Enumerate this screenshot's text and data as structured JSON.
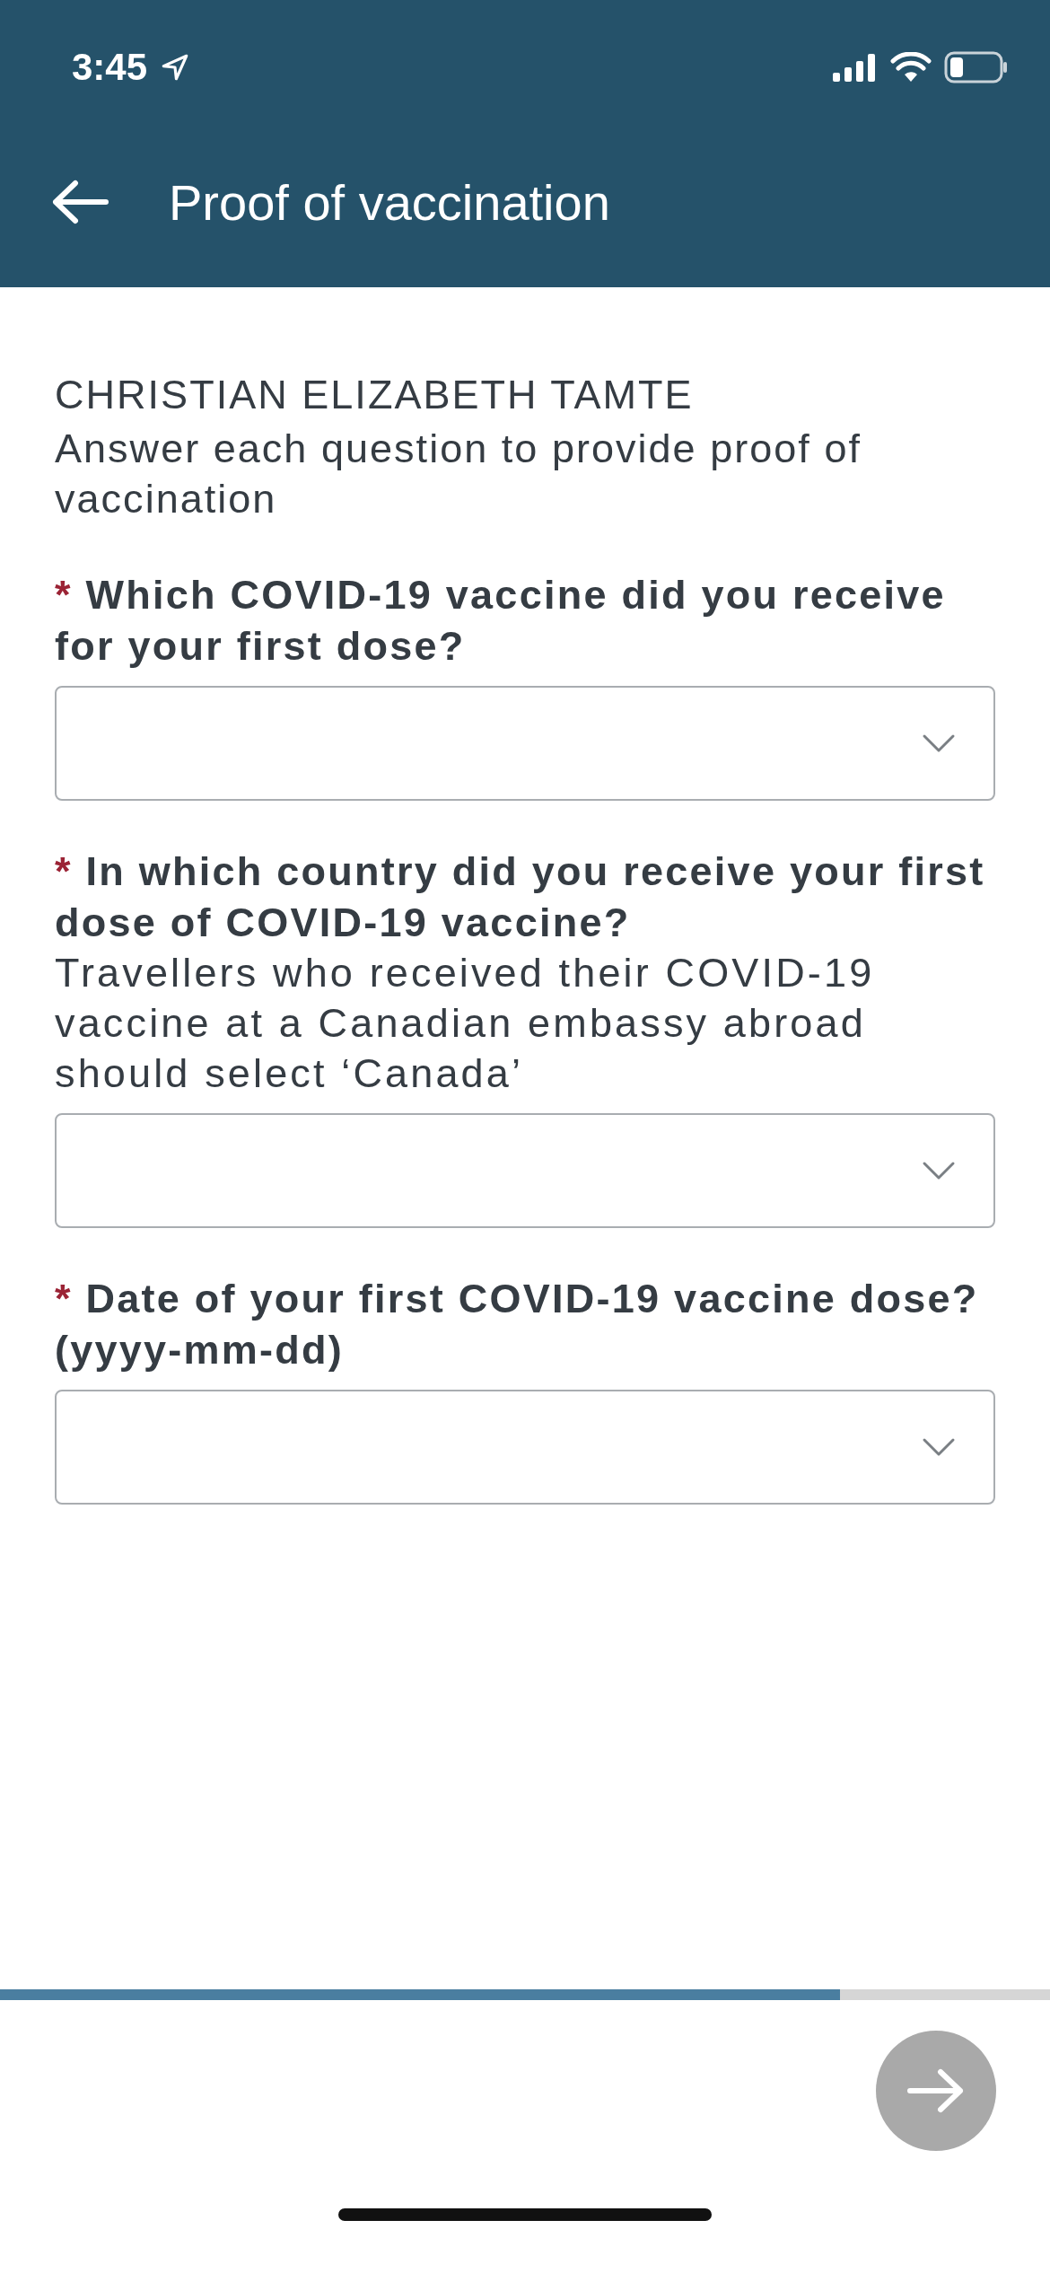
{
  "status_bar": {
    "time": "3:45"
  },
  "nav_bar": {
    "title": "Proof of vaccination"
  },
  "traveller_name": "CHRISTIAN ELIZABETH TAMTE",
  "instructions": "Answer each question to provide proof of vaccination",
  "questions": [
    {
      "required_mark": "*",
      "label": "Which COVID-19 vaccine did you receive for your first dose?"
    },
    {
      "required_mark": "*",
      "label": "In which country did you receive your first dose of COVID-19 vaccine?",
      "hint": "Travellers who received their COVID-19 vaccine at a Canadian embassy abroad should select ‘Canada’"
    },
    {
      "required_mark": "*",
      "label": "Date of your first COVID-19 vaccine dose? (yyyy-mm-dd)"
    }
  ],
  "progress": {
    "level": 0.8
  },
  "next_button": {
    "disabled": true
  }
}
